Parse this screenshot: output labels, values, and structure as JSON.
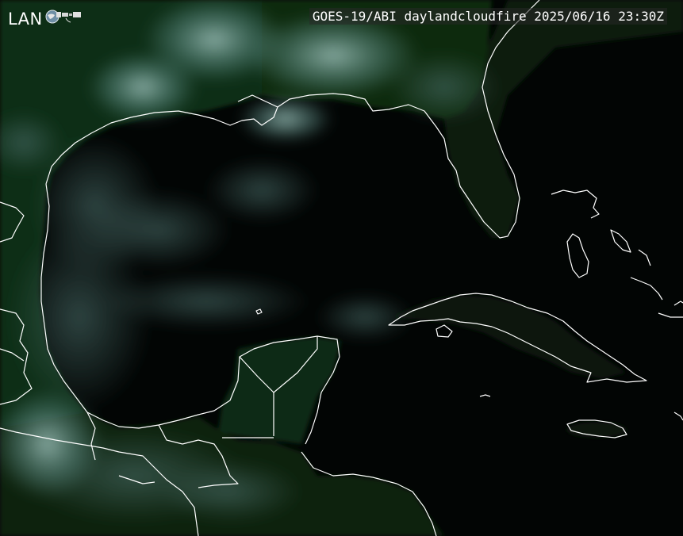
{
  "logo": {
    "text": "LAN",
    "icon": "globe-satellite-icon"
  },
  "caption": {
    "product": "GOES-19/ABI",
    "name": "daylandcloudfire",
    "date": "2025/06/16",
    "time": "23:30Z"
  },
  "colors": {
    "ocean": "#020504",
    "land_vegetation": "#0e2d12",
    "cloud": "#5f8f88",
    "border": "#ffffff",
    "caption_bg": "#282828"
  }
}
